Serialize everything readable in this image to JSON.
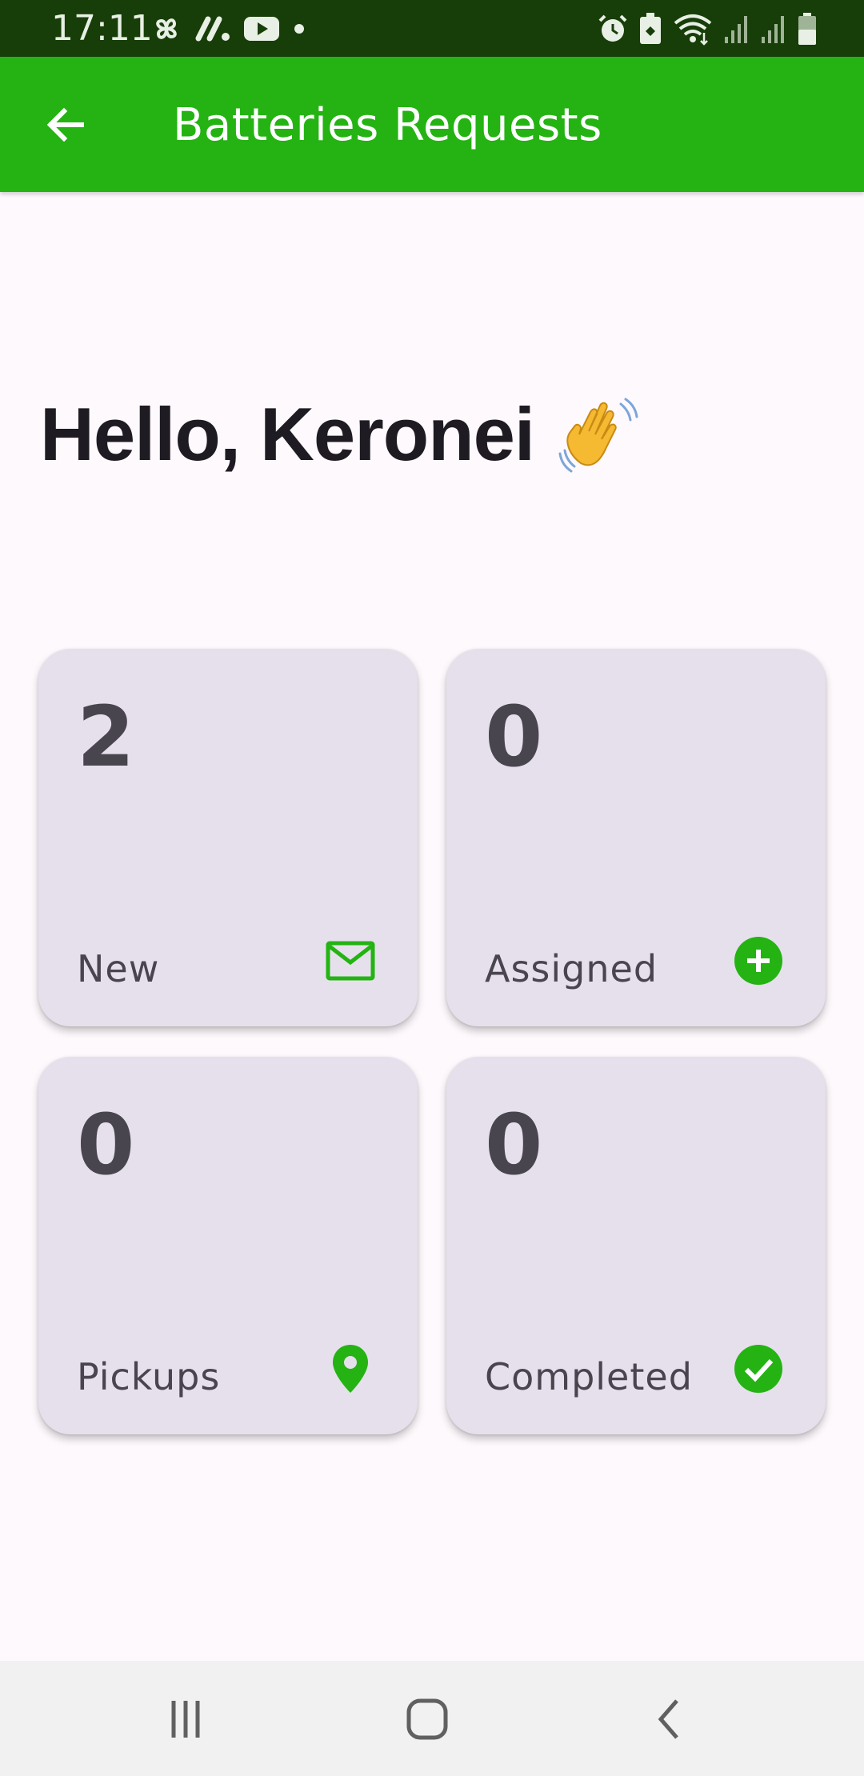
{
  "status_bar": {
    "time": "17:11",
    "icons_left": [
      "pinwheel-icon",
      "app-logo-icon",
      "youtube-icon",
      "dot-icon"
    ],
    "icons_right": [
      "alarm-icon",
      "battery-saver-icon",
      "wifi-icon",
      "signal-1-icon",
      "signal-2-icon",
      "battery-icon"
    ]
  },
  "app_bar": {
    "title": "Batteries Requests",
    "back_icon": "arrow-back-icon",
    "color": "#24b313"
  },
  "greeting": {
    "text": "Hello, Keronei",
    "emoji_icon": "waving-hand-icon"
  },
  "cards": [
    {
      "count": "2",
      "label": "New",
      "icon": "mail-icon"
    },
    {
      "count": "0",
      "label": "Assigned",
      "icon": "add-circle-icon"
    },
    {
      "count": "0",
      "label": "Pickups",
      "icon": "location-pin-icon"
    },
    {
      "count": "0",
      "label": "Completed",
      "icon": "check-circle-icon"
    }
  ],
  "colors": {
    "accent": "#24b313",
    "card_bg": "#e6e0ec",
    "card_text": "#49454f",
    "page_bg": "#fef9fd"
  },
  "nav_bar": {
    "buttons": [
      "recent-apps-icon",
      "home-icon",
      "back-nav-icon"
    ]
  }
}
